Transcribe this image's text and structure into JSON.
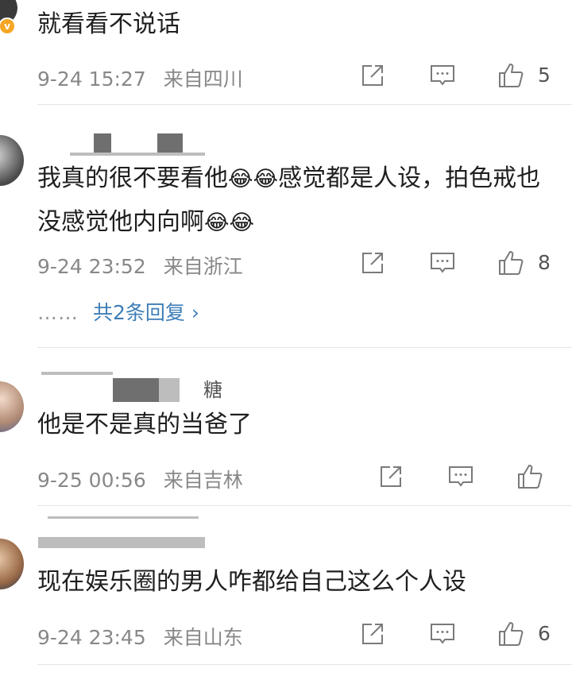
{
  "colors": {
    "link": "#3e7eb8",
    "meta": "#888888",
    "divider": "#e5e5e5",
    "verified": "#f5a623"
  },
  "comments": [
    {
      "text": "就看看不说话",
      "time": "9-24 15:27",
      "location": "来自四川",
      "likes": "5",
      "verified_badge": "v"
    },
    {
      "text_parts": [
        "我真的很不要看他",
        "😂😂",
        "感觉都是人设，拍色戒也没感觉他内向啊",
        "😂😂"
      ],
      "time": "9-24 23:52",
      "location": "来自浙江",
      "likes": "8",
      "replies": {
        "dots": "……",
        "link": "共2条回复 ›"
      }
    },
    {
      "username_fragment": "糖",
      "text": "他是不是真的当爸了",
      "time": "9-25 00:56",
      "location": "来自吉林",
      "likes": ""
    },
    {
      "text": "现在娱乐圈的男人咋都给自己这么个人设",
      "time": "9-24 23:45",
      "location": "来自山东",
      "likes": "6"
    }
  ],
  "icons": {
    "share": "share-icon",
    "comment": "comment-icon",
    "like": "like-icon"
  }
}
